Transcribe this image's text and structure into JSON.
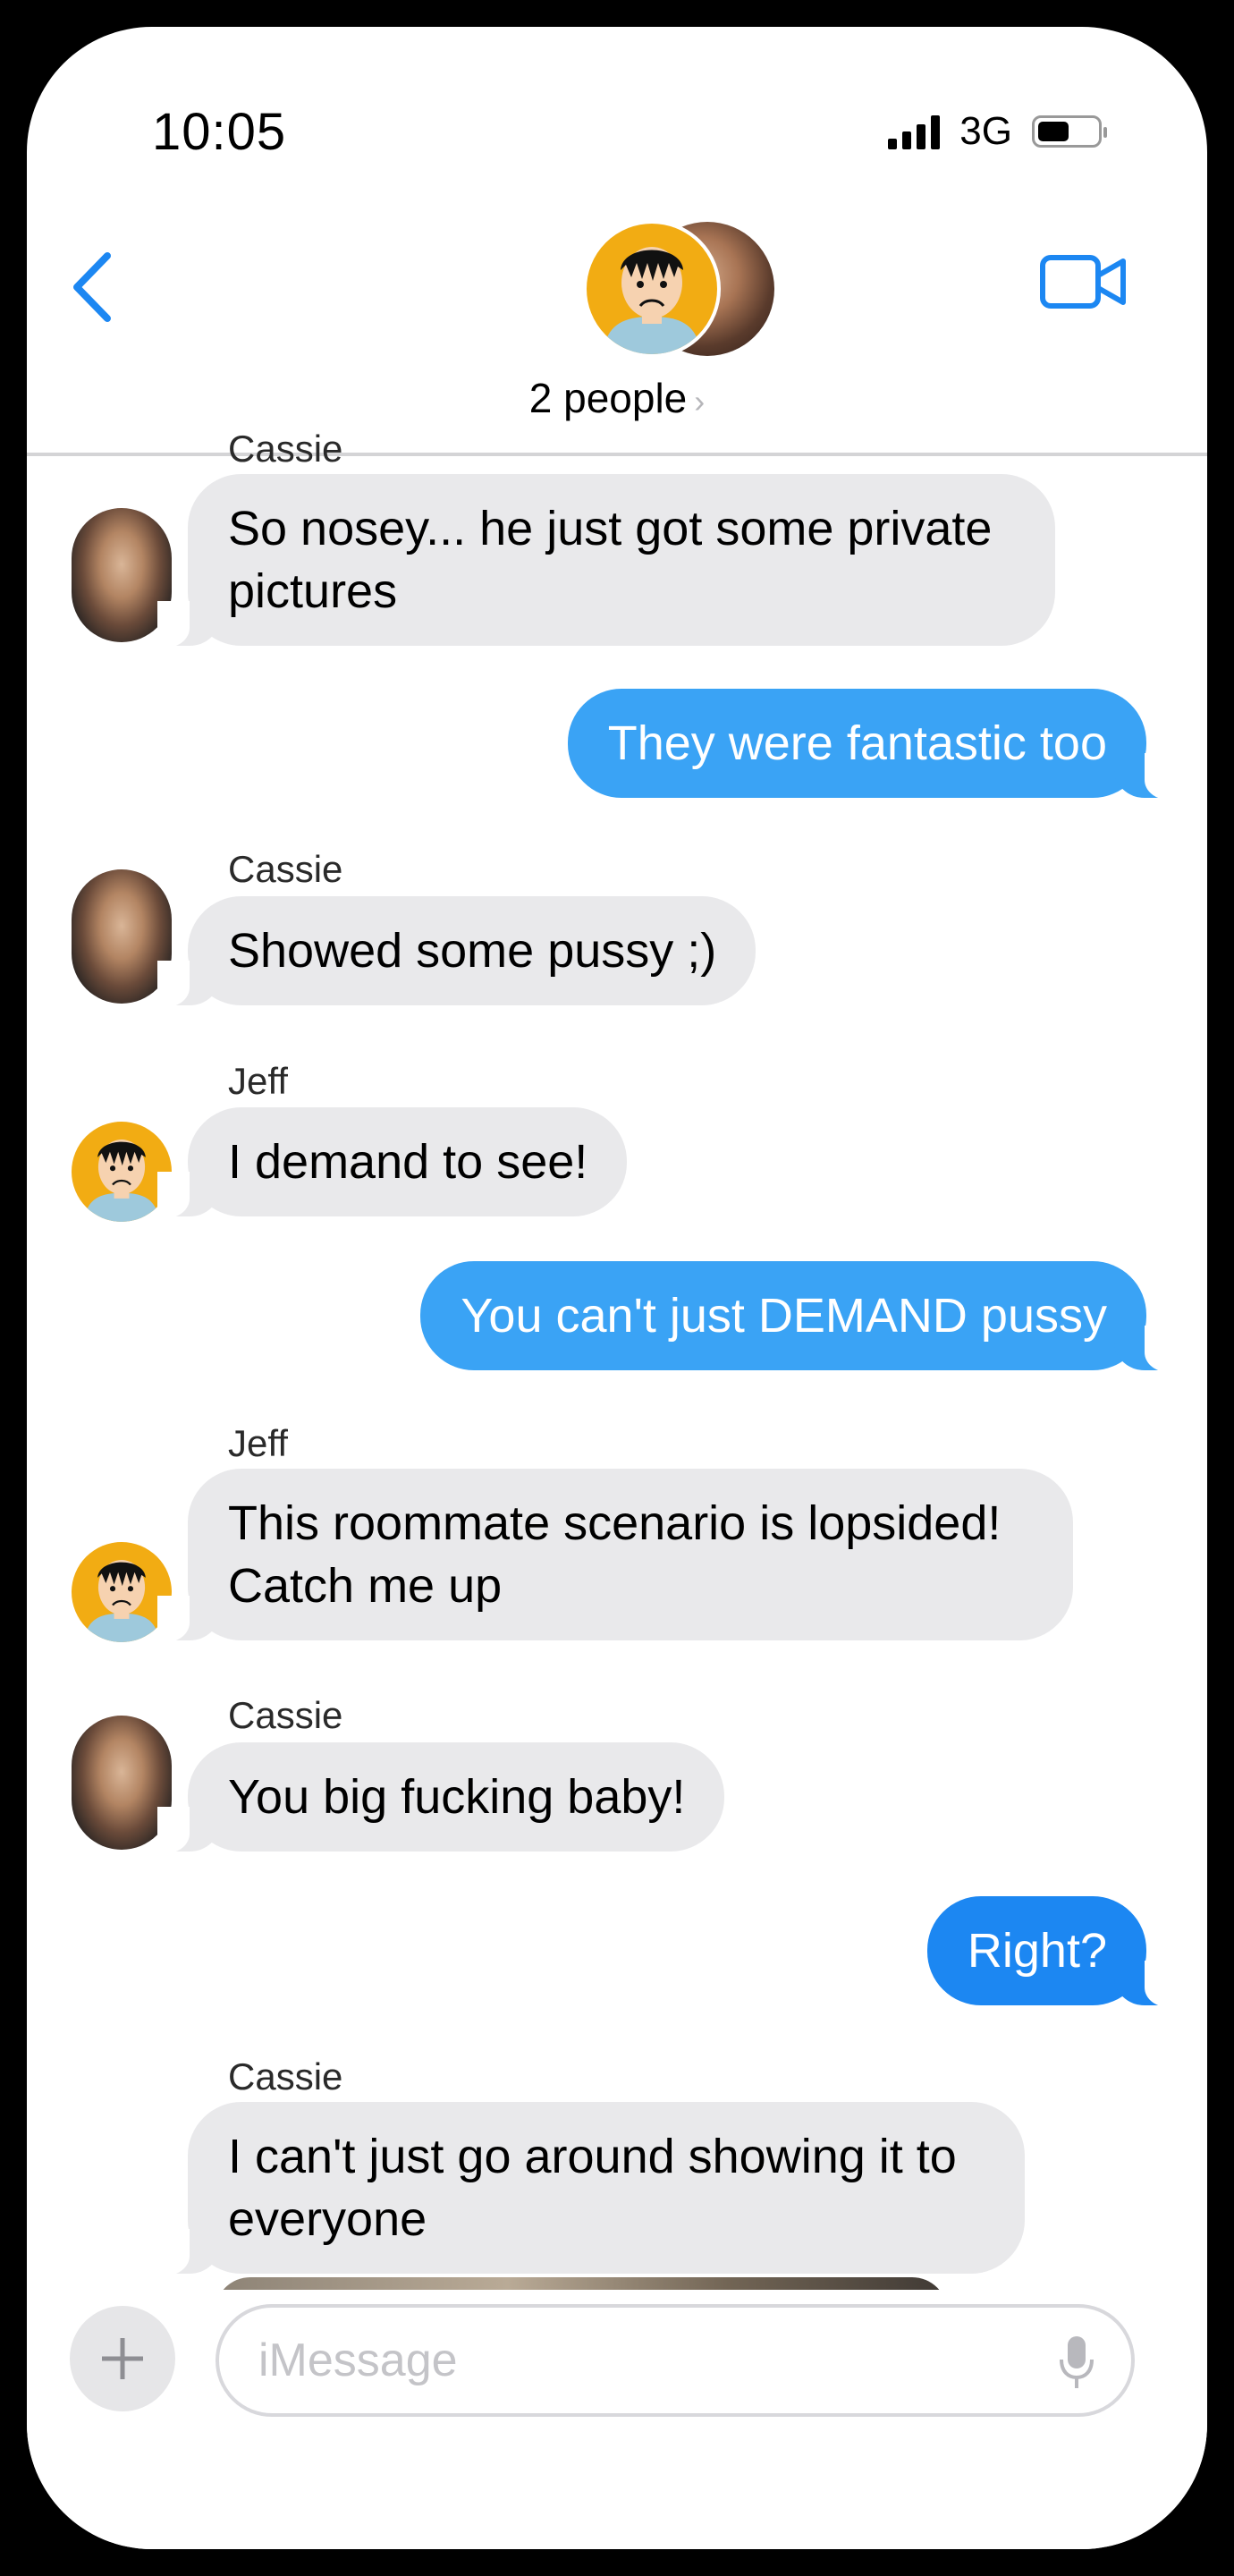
{
  "status_bar": {
    "time": "10:05",
    "network": "3G",
    "signal_icon": "cellular-signal-icon",
    "battery_icon": "battery-icon"
  },
  "header": {
    "back_icon": "chevron-left-icon",
    "video_icon": "video-camera-icon",
    "group_label": "2 people",
    "group_chevron": "›"
  },
  "colors": {
    "accent": "#1c87f2",
    "outgoing_bubble": "#3aa3f5",
    "incoming_bubble": "#e9e9eb",
    "jeff_avatar": "#f2ac13"
  },
  "messages": [
    {
      "sender": "Cassie",
      "direction": "incoming",
      "text": "So nosey... he just got some private\npictures"
    },
    {
      "sender": "",
      "direction": "outgoing",
      "text": "They were fantastic too"
    },
    {
      "sender": "Cassie",
      "direction": "incoming",
      "text": "Showed some pussy ;)"
    },
    {
      "sender": "Jeff",
      "direction": "incoming",
      "text": "I demand to see!"
    },
    {
      "sender": "",
      "direction": "outgoing",
      "text": "You can't just DEMAND pussy"
    },
    {
      "sender": "Jeff",
      "direction": "incoming",
      "text": "This roommate scenario is lopsided!\nCatch me up"
    },
    {
      "sender": "Cassie",
      "direction": "incoming",
      "text": "You big fucking baby!"
    },
    {
      "sender": "",
      "direction": "outgoing",
      "text": "Right?"
    },
    {
      "sender": "Cassie",
      "direction": "incoming",
      "text": "I can't just go around showing it to\neveryone"
    }
  ],
  "compose": {
    "placeholder": "iMessage",
    "plus_icon": "plus-icon",
    "mic_icon": "microphone-icon"
  }
}
